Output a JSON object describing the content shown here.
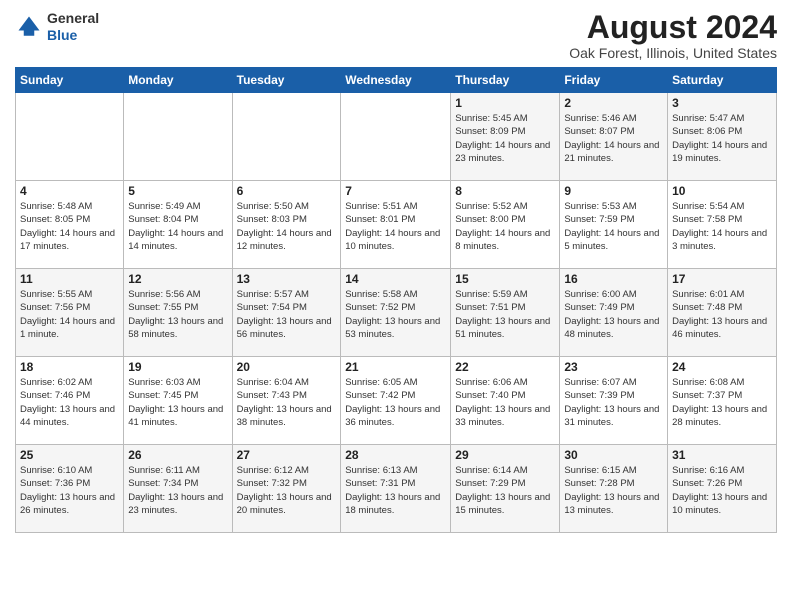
{
  "logo": {
    "line1": "General",
    "line2": "Blue"
  },
  "title": "August 2024",
  "location": "Oak Forest, Illinois, United States",
  "days_of_week": [
    "Sunday",
    "Monday",
    "Tuesday",
    "Wednesday",
    "Thursday",
    "Friday",
    "Saturday"
  ],
  "weeks": [
    [
      {
        "day": "",
        "info": ""
      },
      {
        "day": "",
        "info": ""
      },
      {
        "day": "",
        "info": ""
      },
      {
        "day": "",
        "info": ""
      },
      {
        "day": "1",
        "info": "Sunrise: 5:45 AM\nSunset: 8:09 PM\nDaylight: 14 hours\nand 23 minutes."
      },
      {
        "day": "2",
        "info": "Sunrise: 5:46 AM\nSunset: 8:07 PM\nDaylight: 14 hours\nand 21 minutes."
      },
      {
        "day": "3",
        "info": "Sunrise: 5:47 AM\nSunset: 8:06 PM\nDaylight: 14 hours\nand 19 minutes."
      }
    ],
    [
      {
        "day": "4",
        "info": "Sunrise: 5:48 AM\nSunset: 8:05 PM\nDaylight: 14 hours\nand 17 minutes."
      },
      {
        "day": "5",
        "info": "Sunrise: 5:49 AM\nSunset: 8:04 PM\nDaylight: 14 hours\nand 14 minutes."
      },
      {
        "day": "6",
        "info": "Sunrise: 5:50 AM\nSunset: 8:03 PM\nDaylight: 14 hours\nand 12 minutes."
      },
      {
        "day": "7",
        "info": "Sunrise: 5:51 AM\nSunset: 8:01 PM\nDaylight: 14 hours\nand 10 minutes."
      },
      {
        "day": "8",
        "info": "Sunrise: 5:52 AM\nSunset: 8:00 PM\nDaylight: 14 hours\nand 8 minutes."
      },
      {
        "day": "9",
        "info": "Sunrise: 5:53 AM\nSunset: 7:59 PM\nDaylight: 14 hours\nand 5 minutes."
      },
      {
        "day": "10",
        "info": "Sunrise: 5:54 AM\nSunset: 7:58 PM\nDaylight: 14 hours\nand 3 minutes."
      }
    ],
    [
      {
        "day": "11",
        "info": "Sunrise: 5:55 AM\nSunset: 7:56 PM\nDaylight: 14 hours\nand 1 minute."
      },
      {
        "day": "12",
        "info": "Sunrise: 5:56 AM\nSunset: 7:55 PM\nDaylight: 13 hours\nand 58 minutes."
      },
      {
        "day": "13",
        "info": "Sunrise: 5:57 AM\nSunset: 7:54 PM\nDaylight: 13 hours\nand 56 minutes."
      },
      {
        "day": "14",
        "info": "Sunrise: 5:58 AM\nSunset: 7:52 PM\nDaylight: 13 hours\nand 53 minutes."
      },
      {
        "day": "15",
        "info": "Sunrise: 5:59 AM\nSunset: 7:51 PM\nDaylight: 13 hours\nand 51 minutes."
      },
      {
        "day": "16",
        "info": "Sunrise: 6:00 AM\nSunset: 7:49 PM\nDaylight: 13 hours\nand 48 minutes."
      },
      {
        "day": "17",
        "info": "Sunrise: 6:01 AM\nSunset: 7:48 PM\nDaylight: 13 hours\nand 46 minutes."
      }
    ],
    [
      {
        "day": "18",
        "info": "Sunrise: 6:02 AM\nSunset: 7:46 PM\nDaylight: 13 hours\nand 44 minutes."
      },
      {
        "day": "19",
        "info": "Sunrise: 6:03 AM\nSunset: 7:45 PM\nDaylight: 13 hours\nand 41 minutes."
      },
      {
        "day": "20",
        "info": "Sunrise: 6:04 AM\nSunset: 7:43 PM\nDaylight: 13 hours\nand 38 minutes."
      },
      {
        "day": "21",
        "info": "Sunrise: 6:05 AM\nSunset: 7:42 PM\nDaylight: 13 hours\nand 36 minutes."
      },
      {
        "day": "22",
        "info": "Sunrise: 6:06 AM\nSunset: 7:40 PM\nDaylight: 13 hours\nand 33 minutes."
      },
      {
        "day": "23",
        "info": "Sunrise: 6:07 AM\nSunset: 7:39 PM\nDaylight: 13 hours\nand 31 minutes."
      },
      {
        "day": "24",
        "info": "Sunrise: 6:08 AM\nSunset: 7:37 PM\nDaylight: 13 hours\nand 28 minutes."
      }
    ],
    [
      {
        "day": "25",
        "info": "Sunrise: 6:10 AM\nSunset: 7:36 PM\nDaylight: 13 hours\nand 26 minutes."
      },
      {
        "day": "26",
        "info": "Sunrise: 6:11 AM\nSunset: 7:34 PM\nDaylight: 13 hours\nand 23 minutes."
      },
      {
        "day": "27",
        "info": "Sunrise: 6:12 AM\nSunset: 7:32 PM\nDaylight: 13 hours\nand 20 minutes."
      },
      {
        "day": "28",
        "info": "Sunrise: 6:13 AM\nSunset: 7:31 PM\nDaylight: 13 hours\nand 18 minutes."
      },
      {
        "day": "29",
        "info": "Sunrise: 6:14 AM\nSunset: 7:29 PM\nDaylight: 13 hours\nand 15 minutes."
      },
      {
        "day": "30",
        "info": "Sunrise: 6:15 AM\nSunset: 7:28 PM\nDaylight: 13 hours\nand 13 minutes."
      },
      {
        "day": "31",
        "info": "Sunrise: 6:16 AM\nSunset: 7:26 PM\nDaylight: 13 hours\nand 10 minutes."
      }
    ]
  ]
}
